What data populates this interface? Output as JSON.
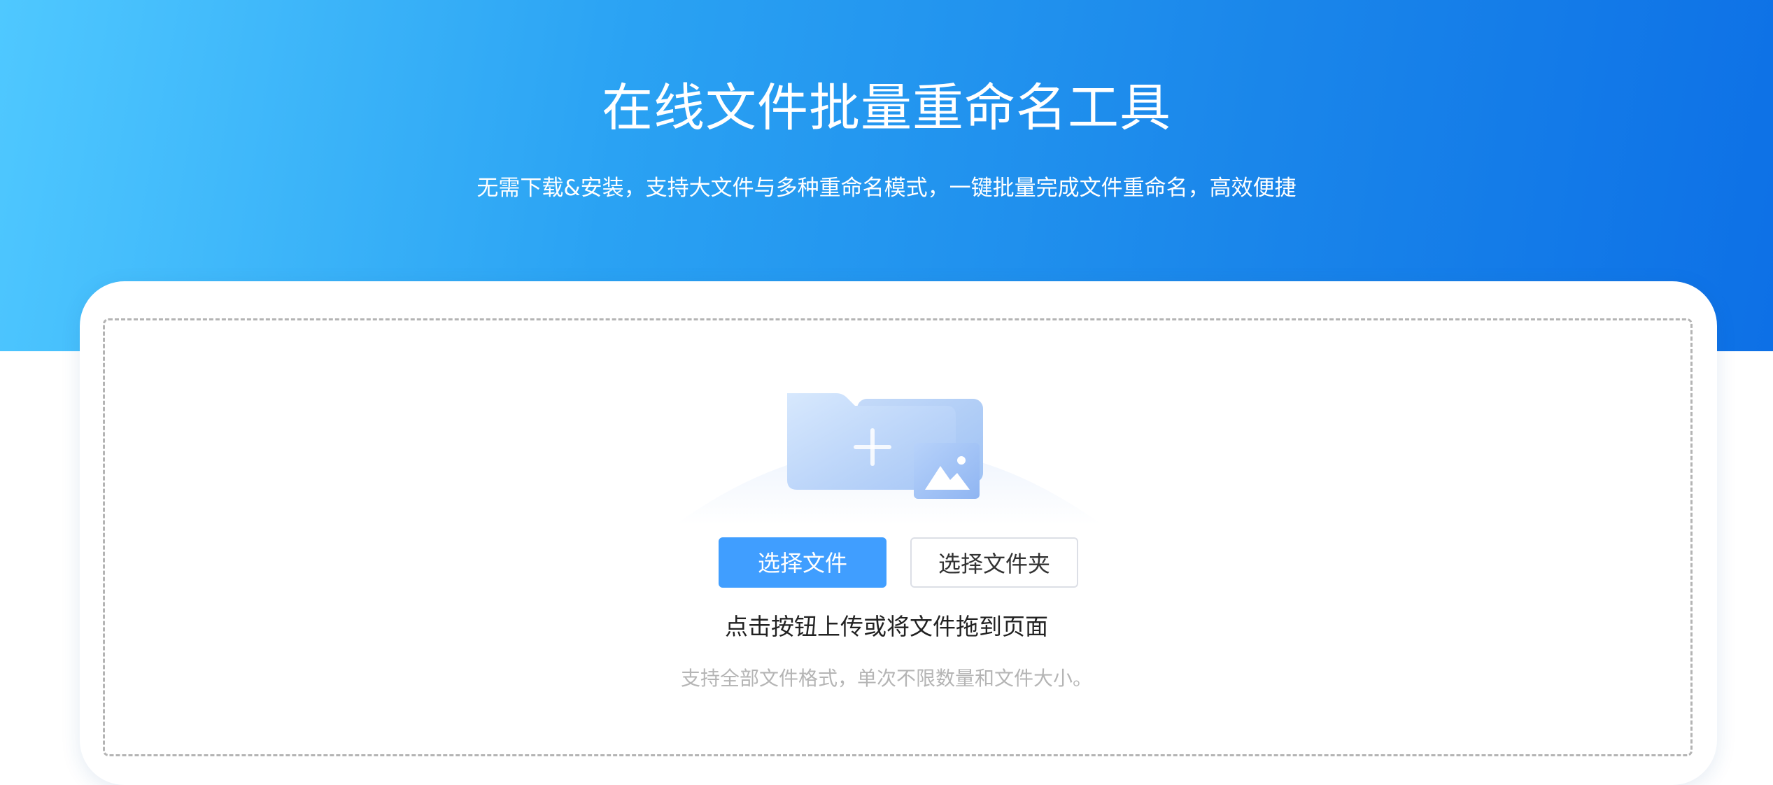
{
  "header": {
    "title": "在线文件批量重命名工具",
    "subtitle": "无需下载&安装，支持大文件与多种重命名模式，一键批量完成文件重命名，高效便捷"
  },
  "upload": {
    "illustration_icon": "folder-add-image-icon",
    "select_file_label": "选择文件",
    "select_folder_label": "选择文件夹",
    "hint": "点击按钮上传或将文件拖到页面",
    "sub_hint": "支持全部文件格式，单次不限数量和文件大小。"
  },
  "colors": {
    "hero_gradient_start": "#4fc8ff",
    "hero_gradient_end": "#0d70e6",
    "primary": "#409eff"
  }
}
